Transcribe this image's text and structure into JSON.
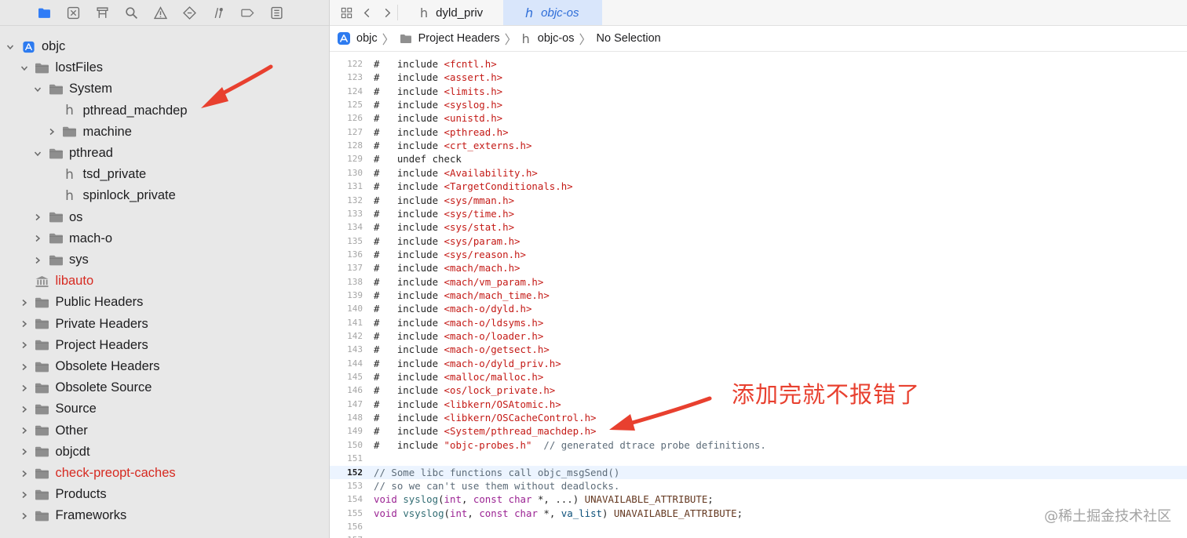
{
  "navigator": {
    "toolbar_icons": [
      "folder-icon",
      "source-control-icon",
      "symbol-icon",
      "search-icon",
      "issue-icon",
      "test-icon",
      "debug-icon",
      "breakpoint-icon",
      "report-icon"
    ],
    "tree": [
      {
        "label": "objc",
        "depth": 0,
        "expanded": true,
        "kind": "project"
      },
      {
        "label": "lostFiles",
        "depth": 1,
        "expanded": true,
        "kind": "folder"
      },
      {
        "label": "System",
        "depth": 2,
        "expanded": true,
        "kind": "folder"
      },
      {
        "label": "pthread_machdep",
        "depth": 3,
        "kind": "header"
      },
      {
        "label": "machine",
        "depth": 3,
        "expanded": false,
        "kind": "folder"
      },
      {
        "label": "pthread",
        "depth": 2,
        "expanded": true,
        "kind": "folder"
      },
      {
        "label": "tsd_private",
        "depth": 3,
        "kind": "header"
      },
      {
        "label": "spinlock_private",
        "depth": 3,
        "kind": "header"
      },
      {
        "label": "os",
        "depth": 2,
        "expanded": false,
        "kind": "folder"
      },
      {
        "label": "mach-o",
        "depth": 2,
        "expanded": false,
        "kind": "folder"
      },
      {
        "label": "sys",
        "depth": 2,
        "expanded": false,
        "kind": "folder"
      },
      {
        "label": "libauto",
        "depth": 1,
        "kind": "library",
        "red": true
      },
      {
        "label": "Public Headers",
        "depth": 1,
        "expanded": false,
        "kind": "folder"
      },
      {
        "label": "Private Headers",
        "depth": 1,
        "expanded": false,
        "kind": "folder"
      },
      {
        "label": "Project Headers",
        "depth": 1,
        "expanded": false,
        "kind": "folder"
      },
      {
        "label": "Obsolete Headers",
        "depth": 1,
        "expanded": false,
        "kind": "folder"
      },
      {
        "label": "Obsolete Source",
        "depth": 1,
        "expanded": false,
        "kind": "folder"
      },
      {
        "label": "Source",
        "depth": 1,
        "expanded": false,
        "kind": "folder"
      },
      {
        "label": "Other",
        "depth": 1,
        "expanded": false,
        "kind": "folder"
      },
      {
        "label": "objcdt",
        "depth": 1,
        "expanded": false,
        "kind": "folder"
      },
      {
        "label": "check-preopt-caches",
        "depth": 1,
        "expanded": false,
        "kind": "folder",
        "red": true
      },
      {
        "label": "Products",
        "depth": 1,
        "expanded": false,
        "kind": "folder"
      },
      {
        "label": "Frameworks",
        "depth": 1,
        "expanded": false,
        "kind": "folder"
      }
    ]
  },
  "editor": {
    "tabs": [
      {
        "label": "dyld_priv",
        "active": false
      },
      {
        "label": "objc-os",
        "active": true
      }
    ],
    "jump_bar": {
      "project": "objc",
      "group": "Project Headers",
      "file": "objc-os",
      "selection": "No Selection"
    },
    "current_line": 152,
    "lines": [
      {
        "n": 122,
        "tokens": [
          [
            "#   include ",
            ""
          ],
          [
            "<fcntl.h>",
            "str"
          ]
        ]
      },
      {
        "n": 123,
        "tokens": [
          [
            "#   include ",
            ""
          ],
          [
            "<assert.h>",
            "str"
          ]
        ]
      },
      {
        "n": 124,
        "tokens": [
          [
            "#   include ",
            ""
          ],
          [
            "<limits.h>",
            "str"
          ]
        ]
      },
      {
        "n": 125,
        "tokens": [
          [
            "#   include ",
            ""
          ],
          [
            "<syslog.h>",
            "str"
          ]
        ]
      },
      {
        "n": 126,
        "tokens": [
          [
            "#   include ",
            ""
          ],
          [
            "<unistd.h>",
            "str"
          ]
        ]
      },
      {
        "n": 127,
        "tokens": [
          [
            "#   include ",
            ""
          ],
          [
            "<pthread.h>",
            "str"
          ]
        ]
      },
      {
        "n": 128,
        "tokens": [
          [
            "#   include ",
            ""
          ],
          [
            "<crt_externs.h>",
            "str"
          ]
        ]
      },
      {
        "n": 129,
        "tokens": [
          [
            "#   undef check",
            ""
          ]
        ]
      },
      {
        "n": 130,
        "tokens": [
          [
            "#   include ",
            ""
          ],
          [
            "<Availability.h>",
            "str"
          ]
        ]
      },
      {
        "n": 131,
        "tokens": [
          [
            "#   include ",
            ""
          ],
          [
            "<TargetConditionals.h>",
            "str"
          ]
        ]
      },
      {
        "n": 132,
        "tokens": [
          [
            "#   include ",
            ""
          ],
          [
            "<sys/mman.h>",
            "str"
          ]
        ]
      },
      {
        "n": 133,
        "tokens": [
          [
            "#   include ",
            ""
          ],
          [
            "<sys/time.h>",
            "str"
          ]
        ]
      },
      {
        "n": 134,
        "tokens": [
          [
            "#   include ",
            ""
          ],
          [
            "<sys/stat.h>",
            "str"
          ]
        ]
      },
      {
        "n": 135,
        "tokens": [
          [
            "#   include ",
            ""
          ],
          [
            "<sys/param.h>",
            "str"
          ]
        ]
      },
      {
        "n": 136,
        "tokens": [
          [
            "#   include ",
            ""
          ],
          [
            "<sys/reason.h>",
            "str"
          ]
        ]
      },
      {
        "n": 137,
        "tokens": [
          [
            "#   include ",
            ""
          ],
          [
            "<mach/mach.h>",
            "str"
          ]
        ]
      },
      {
        "n": 138,
        "tokens": [
          [
            "#   include ",
            ""
          ],
          [
            "<mach/vm_param.h>",
            "str"
          ]
        ]
      },
      {
        "n": 139,
        "tokens": [
          [
            "#   include ",
            ""
          ],
          [
            "<mach/mach_time.h>",
            "str"
          ]
        ]
      },
      {
        "n": 140,
        "tokens": [
          [
            "#   include ",
            ""
          ],
          [
            "<mach-o/dyld.h>",
            "str"
          ]
        ]
      },
      {
        "n": 141,
        "tokens": [
          [
            "#   include ",
            ""
          ],
          [
            "<mach-o/ldsyms.h>",
            "str"
          ]
        ]
      },
      {
        "n": 142,
        "tokens": [
          [
            "#   include ",
            ""
          ],
          [
            "<mach-o/loader.h>",
            "str"
          ]
        ]
      },
      {
        "n": 143,
        "tokens": [
          [
            "#   include ",
            ""
          ],
          [
            "<mach-o/getsect.h>",
            "str"
          ]
        ]
      },
      {
        "n": 144,
        "tokens": [
          [
            "#   include ",
            ""
          ],
          [
            "<mach-o/dyld_priv.h>",
            "str"
          ]
        ]
      },
      {
        "n": 145,
        "tokens": [
          [
            "#   include ",
            ""
          ],
          [
            "<malloc/malloc.h>",
            "str"
          ]
        ]
      },
      {
        "n": 146,
        "tokens": [
          [
            "#   include ",
            ""
          ],
          [
            "<os/lock_private.h>",
            "str"
          ]
        ]
      },
      {
        "n": 147,
        "tokens": [
          [
            "#   include ",
            ""
          ],
          [
            "<libkern/OSAtomic.h>",
            "str"
          ]
        ]
      },
      {
        "n": 148,
        "tokens": [
          [
            "#   include ",
            ""
          ],
          [
            "<libkern/OSCacheControl.h>",
            "str"
          ]
        ]
      },
      {
        "n": 149,
        "tokens": [
          [
            "#   include ",
            ""
          ],
          [
            "<System/pthread_machdep.h>",
            "str"
          ]
        ]
      },
      {
        "n": 150,
        "tokens": [
          [
            "#   include ",
            ""
          ],
          [
            "\"objc-probes.h\"",
            "str"
          ],
          [
            "  ",
            ""
          ],
          [
            "// generated dtrace probe definitions.",
            "cmt"
          ]
        ]
      },
      {
        "n": 151,
        "tokens": []
      },
      {
        "n": 152,
        "tokens": [
          [
            "// Some libc functions call objc_msgSend()",
            "cmt"
          ]
        ]
      },
      {
        "n": 153,
        "tokens": [
          [
            "// so we can't use them without deadlocks.",
            "cmt"
          ]
        ]
      },
      {
        "n": 154,
        "tokens": [
          [
            "void",
            "kw"
          ],
          [
            " ",
            ""
          ],
          [
            "syslog",
            "fn"
          ],
          [
            "(",
            ""
          ],
          [
            "int",
            "kw"
          ],
          [
            ", ",
            ""
          ],
          [
            "const",
            "kw"
          ],
          [
            " ",
            ""
          ],
          [
            "char",
            "kw"
          ],
          [
            " *, ...) ",
            ""
          ],
          [
            "UNAVAILABLE_ATTRIBUTE",
            "macro"
          ],
          [
            ";",
            ""
          ]
        ]
      },
      {
        "n": 155,
        "tokens": [
          [
            "void",
            "kw"
          ],
          [
            " ",
            ""
          ],
          [
            "vsyslog",
            "fn"
          ],
          [
            "(",
            ""
          ],
          [
            "int",
            "kw"
          ],
          [
            ", ",
            ""
          ],
          [
            "const",
            "kw"
          ],
          [
            " ",
            ""
          ],
          [
            "char",
            "kw"
          ],
          [
            " *, ",
            ""
          ],
          [
            "va_list",
            "type"
          ],
          [
            ") ",
            ""
          ],
          [
            "UNAVAILABLE_ATTRIBUTE",
            "macro"
          ],
          [
            ";",
            ""
          ]
        ]
      },
      {
        "n": 156,
        "tokens": []
      },
      {
        "n": 157,
        "tokens": []
      }
    ]
  },
  "annotation": {
    "text": "添加完就不报错了",
    "color": "#e8402f"
  },
  "watermark": "@稀土掘金技术社区",
  "colors": {
    "accent": "#2f7cf6",
    "missing_file_red": "#d62a21",
    "string": "#c41a16",
    "comment": "#5d6c79",
    "keyword": "#9b2393"
  }
}
